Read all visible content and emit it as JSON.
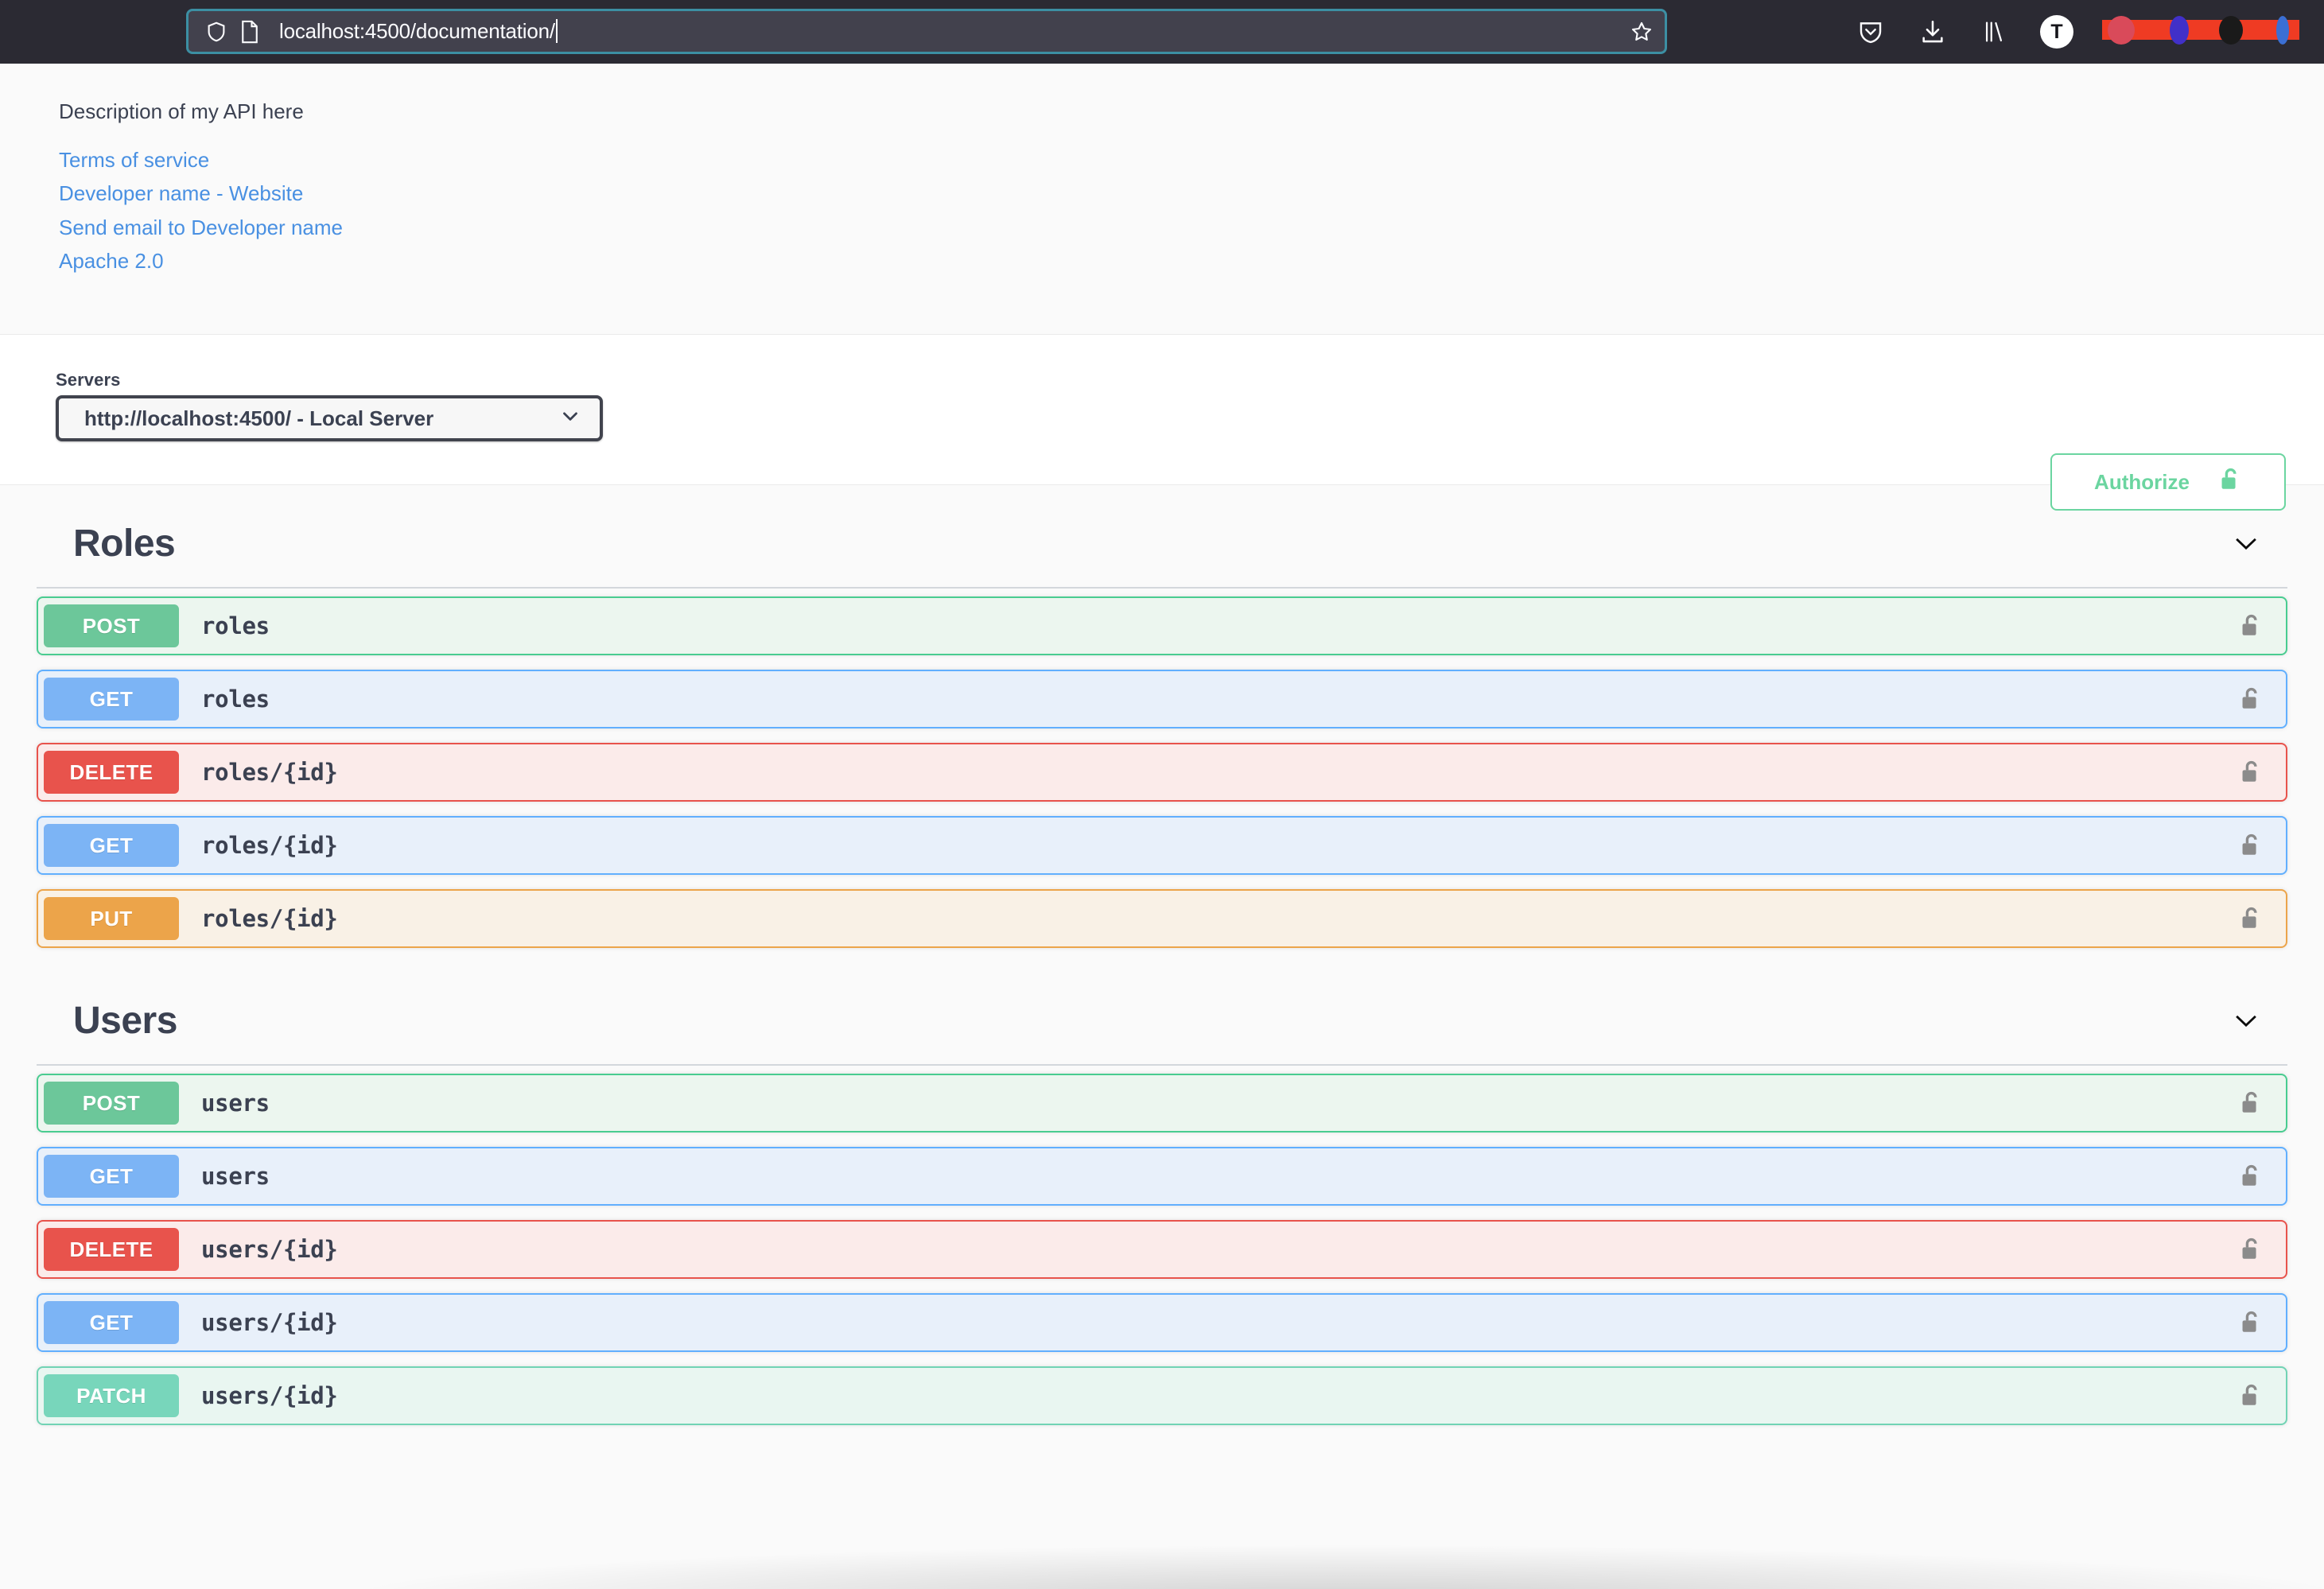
{
  "browser": {
    "url": "localhost:4500/documentation/",
    "shield_icon": "shield-icon",
    "page_icon": "page-icon",
    "bookmark_icon": "star-icon",
    "pocket_icon": "pocket-icon",
    "downloads_icon": "download-icon",
    "library_icon": "library-icon",
    "account_initial": "T",
    "chrome_bg": "#2b2a33",
    "urlbar_bg": "#42414d",
    "urlbar_focus_border": "#3c8fa3",
    "redaction_color": "#ef3b23"
  },
  "info": {
    "description": "Description of my API here",
    "links": [
      {
        "label": "Terms of service"
      },
      {
        "label": "Developer name - Website"
      },
      {
        "label": "Send email to Developer name"
      },
      {
        "label": "Apache 2.0"
      }
    ],
    "link_color": "#4990e2"
  },
  "servers": {
    "label": "Servers",
    "selected": "http://localhost:4500/ - Local Server",
    "options": [
      "http://localhost:4500/ - Local Server"
    ],
    "chevron_icon": "chevron-down-icon"
  },
  "authorize": {
    "label": "Authorize",
    "lock_icon": "unlocked-padlock-icon",
    "color": "#6bd5a0"
  },
  "tags": [
    {
      "title": "Roles",
      "chevron_icon": "chevron-down-icon",
      "operations": [
        {
          "method": "POST",
          "path": "roles",
          "style": "m-post",
          "lock_icon": "unlocked-padlock-icon"
        },
        {
          "method": "GET",
          "path": "roles",
          "style": "m-get",
          "lock_icon": "unlocked-padlock-icon"
        },
        {
          "method": "DELETE",
          "path": "roles/{id}",
          "style": "m-delete",
          "lock_icon": "unlocked-padlock-icon"
        },
        {
          "method": "GET",
          "path": "roles/{id}",
          "style": "m-get",
          "lock_icon": "unlocked-padlock-icon"
        },
        {
          "method": "PUT",
          "path": "roles/{id}",
          "style": "m-put",
          "lock_icon": "unlocked-padlock-icon"
        }
      ]
    },
    {
      "title": "Users",
      "chevron_icon": "chevron-down-icon",
      "operations": [
        {
          "method": "POST",
          "path": "users",
          "style": "m-post",
          "lock_icon": "unlocked-padlock-icon"
        },
        {
          "method": "GET",
          "path": "users",
          "style": "m-get",
          "lock_icon": "unlocked-padlock-icon"
        },
        {
          "method": "DELETE",
          "path": "users/{id}",
          "style": "m-delete",
          "lock_icon": "unlocked-padlock-icon"
        },
        {
          "method": "GET",
          "path": "users/{id}",
          "style": "m-get",
          "lock_icon": "unlocked-padlock-icon"
        },
        {
          "method": "PATCH",
          "path": "users/{id}",
          "style": "m-patch",
          "lock_icon": "unlocked-padlock-icon"
        }
      ]
    }
  ]
}
